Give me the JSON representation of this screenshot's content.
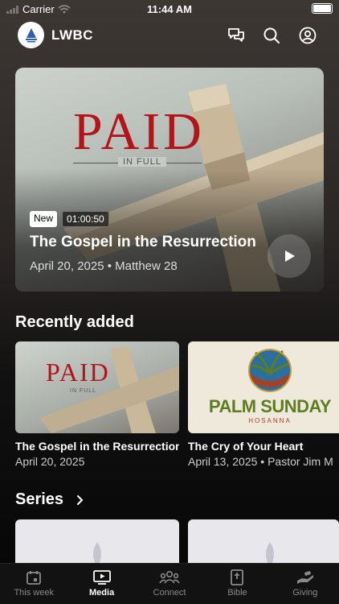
{
  "status": {
    "carrier": "Carrier",
    "time": "11:44 AM"
  },
  "header": {
    "title": "LWBC"
  },
  "hero": {
    "art_title": "PAID",
    "art_subtitle": "IN FULL",
    "badge_new": "New",
    "duration": "01:00:50",
    "title": "The Gospel in the Resurrection",
    "meta": "April 20, 2025 • Matthew 28"
  },
  "recent": {
    "heading": "Recently added",
    "items": [
      {
        "art_title": "PAID",
        "art_subtitle": "IN FULL",
        "title": "The Gospel in the Resurrection",
        "subtitle": "April 20, 2025"
      },
      {
        "art_title": "PALM SUNDAY",
        "art_subtitle": "HOSANNA",
        "title": "The Cry of Your Heart",
        "subtitle": "April 13, 2025 • Pastor Jim M"
      }
    ]
  },
  "series": {
    "heading": "Series"
  },
  "tabs": [
    {
      "label": "This week",
      "icon": "calendar-icon"
    },
    {
      "label": "Media",
      "icon": "tv-icon",
      "active": true
    },
    {
      "label": "Connect",
      "icon": "people-icon"
    },
    {
      "label": "Bible",
      "icon": "bible-icon"
    },
    {
      "label": "Giving",
      "icon": "giving-icon"
    }
  ],
  "colors": {
    "accent_red": "#b3141b",
    "palm_green": "#5e7d1f"
  }
}
